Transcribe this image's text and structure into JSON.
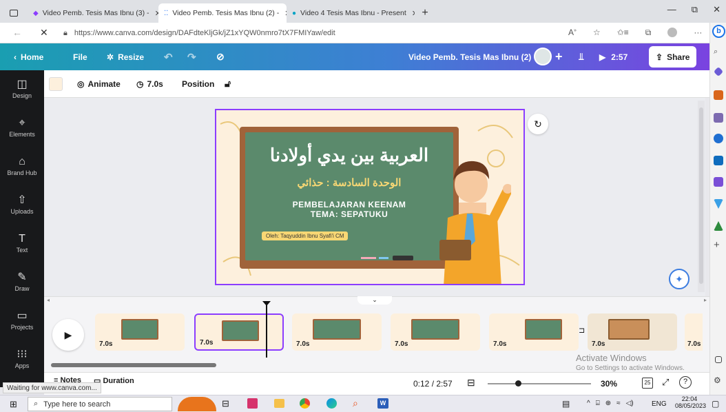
{
  "browser": {
    "tabs": [
      {
        "title": "Video Pemb. Tesis Mas Ibnu (3) -",
        "active": false
      },
      {
        "title": "Video Pemb. Tesis Mas Ibnu (2) -",
        "active": true
      },
      {
        "title": "Video 4 Tesis Mas Ibnu - Present",
        "active": false
      }
    ],
    "url": "https://www.canva.com/design/DAFdteKljGk/jZ1xYQW0nmro7tX7FMIYaw/edit",
    "url_bold": "www.canva.com"
  },
  "topbar": {
    "home": "Home",
    "file": "File",
    "resize": "Resize",
    "doc_title": "Video Pemb. Tesis Mas Ibnu (2)",
    "play_time": "2:57",
    "share": "Share"
  },
  "rail": [
    {
      "label": "Design",
      "icon": "layout-icon"
    },
    {
      "label": "Elements",
      "icon": "shapes-icon"
    },
    {
      "label": "Brand Hub",
      "icon": "brand-icon"
    },
    {
      "label": "Uploads",
      "icon": "upload-icon"
    },
    {
      "label": "Text",
      "icon": "text-icon"
    },
    {
      "label": "Draw",
      "icon": "draw-icon"
    },
    {
      "label": "Projects",
      "icon": "folder-icon"
    },
    {
      "label": "Apps",
      "icon": "apps-icon"
    }
  ],
  "toolbar": {
    "animate": "Animate",
    "duration": "7.0s",
    "position": "Position"
  },
  "slide": {
    "arabic_title": "العربية بين يدي أولادنا",
    "arabic_sub": "الوحدة السادسة : حذائي",
    "line1": "PEMBELAJARAN KEENAM",
    "line2": "TEMA: SEPATUKU",
    "author": "Oleh: Taqyuddin Ibnu Syafi'i CM"
  },
  "timeline": {
    "thumbs": [
      {
        "dur": "7.0s",
        "selected": false
      },
      {
        "dur": "7.0s",
        "selected": true
      },
      {
        "dur": "7.0s",
        "selected": false
      },
      {
        "dur": "7.0s",
        "selected": false
      },
      {
        "dur": "7.0s",
        "selected": false
      },
      {
        "dur": "7.0s",
        "selected": false
      },
      {
        "dur": "7.0s",
        "selected": false
      }
    ]
  },
  "bottom": {
    "notes": "Notes",
    "duration": "Duration",
    "time": "0:12 / 2:57",
    "zoom": "30%",
    "page_num": "25",
    "progress": 0.07
  },
  "watermark": {
    "line1": "Activate Windows",
    "line2": "Go to Settings to activate Windows."
  },
  "status_text": "Waiting for www.canva.com...",
  "taskbar": {
    "search_placeholder": "Type here to search",
    "lang": "ENG",
    "time": "22:04",
    "date": "08/05/2023"
  },
  "colors": {
    "brand_gradient_start": "#1a9eb1",
    "brand_gradient_end": "#7a43e0",
    "selection": "#8b3dff",
    "board_green": "#5b8a6c"
  }
}
